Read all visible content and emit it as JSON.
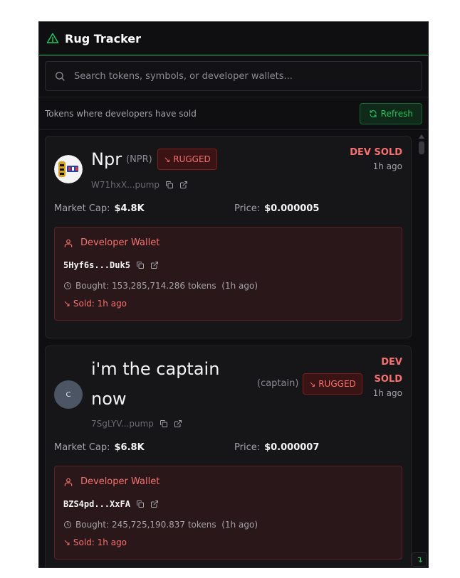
{
  "header": {
    "title": "Rug Tracker"
  },
  "search": {
    "placeholder": "Search tokens, symbols, or developer wallets..."
  },
  "subbar": {
    "note": "Tokens where developers have sold",
    "refresh_label": "Refresh"
  },
  "labels": {
    "market_cap": "Market Cap:",
    "price": "Price:",
    "developer_wallet": "Developer Wallet",
    "badge": "RUGGED",
    "dev_sold": "DEV SOLD",
    "dev_sold_line1": "DEV",
    "dev_sold_line2": "SOLD"
  },
  "tokens": [
    {
      "name": "Npr",
      "symbol": "(NPR)",
      "address": "W71hxX...pump",
      "time": "1h ago",
      "market_cap": "$4.8K",
      "price": "$0.000005",
      "dev_wallet": "5Hyf6s...Duk5",
      "bought": "Bought: 153,285,714.286 tokens",
      "bought_ago": "(1h ago)",
      "sold": "Sold: 1h ago"
    },
    {
      "name_line1": "i'm the captain",
      "name_line2": "now",
      "avatar_letter": "C",
      "symbol": "(captain)",
      "address": "7SgLYV...pump",
      "time": "1h ago",
      "market_cap": "$6.8K",
      "price": "$0.000007",
      "dev_wallet": "BZS4pd...XxFA",
      "bought": "Bought: 245,725,190.837 tokens",
      "bought_ago": "(1h ago)",
      "sold": "Sold: 1h ago"
    }
  ],
  "colors": {
    "accent_green": "#22c55e",
    "danger_red": "#f87171",
    "background": "#0f0f11"
  }
}
